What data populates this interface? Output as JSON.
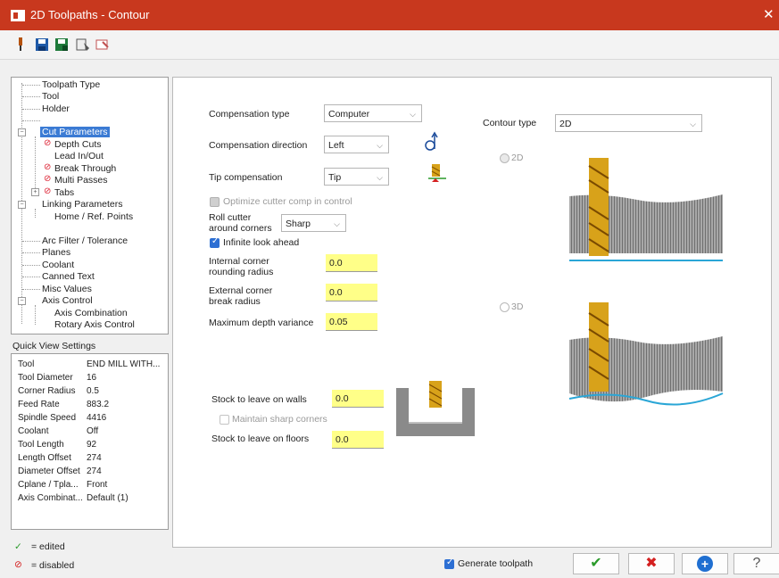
{
  "window": {
    "title": "2D Toolpaths - Contour",
    "close_glyph": "✕"
  },
  "toolbar": {
    "icons": [
      "tool-pin-icon",
      "save-icon",
      "save-as-icon",
      "view-sheet-icon",
      "pick-entity-icon"
    ]
  },
  "tree": {
    "toolpath_type": "Toolpath Type",
    "tool": "Tool",
    "holder": "Holder",
    "cut_parameters": "Cut Parameters",
    "depth_cuts": "Depth Cuts",
    "lead_in_out": "Lead In/Out",
    "break_through": "Break Through",
    "multi_passes": "Multi Passes",
    "tabs": "Tabs",
    "linking_parameters": "Linking Parameters",
    "home_ref_points": "Home / Ref. Points",
    "arc_filter": "Arc Filter / Tolerance",
    "planes": "Planes",
    "coolant": "Coolant",
    "canned_text": "Canned Text",
    "misc_values": "Misc Values",
    "axis_control": "Axis Control",
    "axis_combination": "Axis Combination",
    "rotary_axis_control": "Rotary Axis Control",
    "disabled_glyph": "⊘",
    "plus_glyph": "+",
    "minus_glyph": "−"
  },
  "quick_view": {
    "label": "Quick View Settings",
    "rows": [
      {
        "k": "Tool",
        "v": "END MILL WITH..."
      },
      {
        "k": "Tool Diameter",
        "v": "16"
      },
      {
        "k": "Corner Radius",
        "v": "0.5"
      },
      {
        "k": "Feed Rate",
        "v": "883.2"
      },
      {
        "k": "Spindle Speed",
        "v": "4416"
      },
      {
        "k": "Coolant",
        "v": "Off"
      },
      {
        "k": "Tool Length",
        "v": "92"
      },
      {
        "k": "Length Offset",
        "v": "274"
      },
      {
        "k": "Diameter Offset",
        "v": "274"
      },
      {
        "k": "Cplane / Tpla...",
        "v": "Front"
      },
      {
        "k": "Axis Combinat...",
        "v": "Default (1)"
      }
    ]
  },
  "legend": {
    "edited_glyph": "✓",
    "edited": "= edited",
    "disabled_glyph": "⊘",
    "disabled": "= disabled"
  },
  "params": {
    "comp_type_label": "Compensation type",
    "comp_type_value": "Computer",
    "comp_dir_label": "Compensation direction",
    "comp_dir_value": "Left",
    "tip_comp_label": "Tip compensation",
    "tip_comp_value": "Tip",
    "optimize_label": "Optimize cutter comp in control",
    "roll_label_1": "Roll cutter",
    "roll_label_2": "around corners",
    "roll_value": "Sharp",
    "infinite_label": "Infinite look ahead",
    "internal_label_1": "Internal corner",
    "internal_label_2": "rounding radius",
    "internal_value": "0.0",
    "external_label_1": "External corner",
    "external_label_2": "break radius",
    "external_value": "0.0",
    "max_depth_label": "Maximum depth variance",
    "max_depth_value": "0.05",
    "stock_walls_label": "Stock to leave on walls",
    "stock_walls_value": "0.0",
    "maintain_label": "Maintain sharp corners",
    "stock_floors_label": "Stock to leave on floors",
    "stock_floors_value": "0.0",
    "contour_type_label": "Contour type",
    "contour_type_value": "2D",
    "radio_2d": "2D",
    "radio_3d": "3D",
    "chevron": "⌵"
  },
  "footer": {
    "generate_label": "Generate toolpath",
    "ok_glyph": "✔",
    "cancel_glyph": "✖",
    "add_glyph": "+",
    "help_glyph": "?"
  },
  "colors": {
    "title_bar": "#c8381e",
    "selected": "#3b7bd4",
    "field_yellow": "#ffff88",
    "ok": "#2a9a2a",
    "cancel": "#d42020",
    "add": "#1f6fd1"
  }
}
